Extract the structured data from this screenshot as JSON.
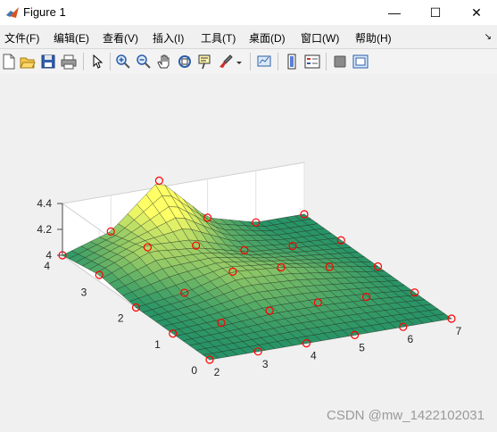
{
  "window": {
    "title": "Figure 1",
    "minimize": "—",
    "maximize": "☐",
    "close": "✕"
  },
  "menu": [
    {
      "label": "文件(F)"
    },
    {
      "label": "编辑(E)"
    },
    {
      "label": "查看(V)"
    },
    {
      "label": "插入(I)"
    },
    {
      "label": "工具(T)"
    },
    {
      "label": "桌面(D)"
    },
    {
      "label": "窗口(W)"
    },
    {
      "label": "帮助(H)"
    }
  ],
  "menu_overflow": "↘",
  "toolbar": {
    "icons": [
      "new-figure-icon",
      "open-file-icon",
      "save-icon",
      "print-icon",
      "select-arrow-icon",
      "zoom-in-icon",
      "zoom-out-icon",
      "pan-hand-icon",
      "rotate-3d-icon",
      "data-cursor-icon",
      "brush-icon",
      "link-plot-icon",
      "colorbar-icon",
      "legend-icon",
      "hide-plot-tools-icon",
      "show-plot-tools-icon"
    ]
  },
  "chart_data": {
    "type": "surface",
    "title": "",
    "xlabel": "",
    "ylabel": "",
    "zlabel": "",
    "x_ticks": [
      "2",
      "3",
      "4",
      "5",
      "6",
      "7"
    ],
    "y_ticks": [
      "0",
      "1",
      "2",
      "3",
      "4"
    ],
    "z_ticks": [
      "4",
      "4.2",
      "4.4"
    ],
    "xlim": [
      2,
      7
    ],
    "ylim": [
      0,
      4
    ],
    "zlim": [
      4,
      4.4
    ],
    "grid": true,
    "colormap": "summer",
    "sample_points": {
      "x": [
        2,
        3,
        4,
        5,
        6,
        7
      ],
      "y": [
        0,
        1,
        2,
        3,
        4
      ],
      "z": [
        [
          4.0,
          4.0,
          4.0,
          4.0,
          4.0,
          4.0
        ],
        [
          4.0,
          4.02,
          4.05,
          4.05,
          4.03,
          4.0
        ],
        [
          4.0,
          4.05,
          4.15,
          4.12,
          4.06,
          4.0
        ],
        [
          4.05,
          4.2,
          4.15,
          4.05,
          4.02,
          4.0
        ],
        [
          4.0,
          4.12,
          4.45,
          4.1,
          4.0,
          4.0
        ]
      ],
      "marker": "o",
      "marker_color": "#ff0000"
    }
  },
  "watermark": "CSDN @mw_1422102031"
}
